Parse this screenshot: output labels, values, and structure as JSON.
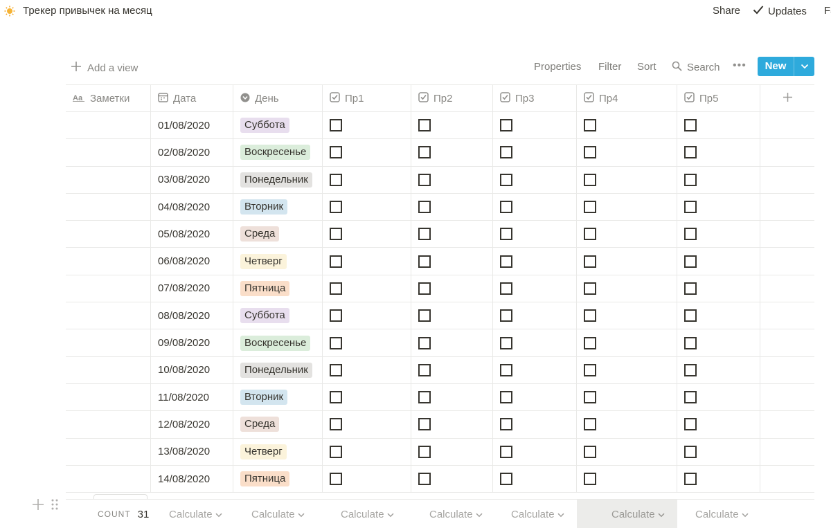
{
  "topbar": {
    "page_title": "Трекер привычек на месяц",
    "share_label": "Share",
    "updates_label": "Updates",
    "favorite_label": "Favorite"
  },
  "viewbar": {
    "add_view_label": "Add a view",
    "properties_label": "Properties",
    "filter_label": "Filter",
    "sort_label": "Sort",
    "search_label": "Search",
    "more_label": "•••",
    "new_label": "New"
  },
  "columns": [
    {
      "label": "Заметки",
      "icon": "text-icon"
    },
    {
      "label": "Дата",
      "icon": "calendar-icon"
    },
    {
      "label": "День",
      "icon": "select-icon"
    },
    {
      "label": "Пр1",
      "icon": "checkbox-icon"
    },
    {
      "label": "Пр2",
      "icon": "checkbox-icon"
    },
    {
      "label": "Пр3",
      "icon": "checkbox-icon"
    },
    {
      "label": "Пр4",
      "icon": "checkbox-icon"
    },
    {
      "label": "Пр5",
      "icon": "checkbox-icon"
    }
  ],
  "day_colors": {
    "Суббота": "#e8deee",
    "Воскресенье": "#dbeddb",
    "Понедельник": "#e3e2e0",
    "Вторник": "#d3e5ef",
    "Среда": "#eee0da",
    "Четверг": "#fbf3db",
    "Пятница": "#fadec9"
  },
  "rows": [
    {
      "date": "01/08/2020",
      "day": "Суббота"
    },
    {
      "date": "02/08/2020",
      "day": "Воскресенье"
    },
    {
      "date": "03/08/2020",
      "day": "Понедельник"
    },
    {
      "date": "04/08/2020",
      "day": "Вторник"
    },
    {
      "date": "05/08/2020",
      "day": "Среда"
    },
    {
      "date": "06/08/2020",
      "day": "Четверг"
    },
    {
      "date": "07/08/2020",
      "day": "Пятница"
    },
    {
      "date": "08/08/2020",
      "day": "Суббота"
    },
    {
      "date": "09/08/2020",
      "day": "Воскресенье"
    },
    {
      "date": "10/08/2020",
      "day": "Понедельник"
    },
    {
      "date": "11/08/2020",
      "day": "Вторник"
    },
    {
      "date": "12/08/2020",
      "day": "Среда"
    },
    {
      "date": "13/08/2020",
      "day": "Четверг"
    },
    {
      "date": "14/08/2020",
      "day": "Пятница"
    }
  ],
  "footer": {
    "count_label": "COUNT",
    "count_value": "31",
    "calculate_label": "Calculate"
  }
}
